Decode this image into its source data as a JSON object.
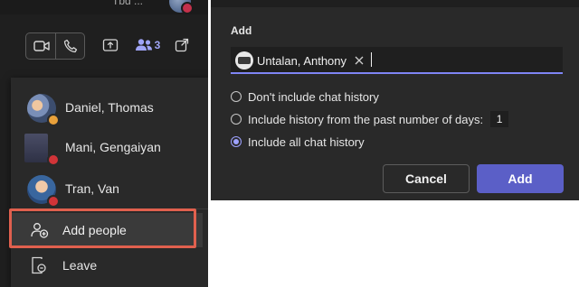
{
  "left_panel": {
    "ghost_text": "Tbd ...",
    "toolbar": {
      "participant_count": "3"
    },
    "participants": [
      {
        "name": "Daniel, Thomas",
        "status": "away"
      },
      {
        "name": "Mani, Gengaiyan",
        "status": "busy"
      },
      {
        "name": "Tran, Van",
        "status": "busy"
      }
    ],
    "add_people_label": "Add people",
    "leave_label": "Leave",
    "highlight_color": "#e0604e"
  },
  "dialog": {
    "heading": "Add",
    "chip_name": "Untalan, Anthony",
    "options": [
      {
        "label": "Don't include chat history",
        "selected": false
      },
      {
        "label": "Include history from the past number of days:",
        "selected": false
      },
      {
        "label": "Include all chat history",
        "selected": true
      }
    ],
    "days_value": "1",
    "cancel_label": "Cancel",
    "add_label": "Add",
    "accent_color": "#5b5fc7"
  }
}
